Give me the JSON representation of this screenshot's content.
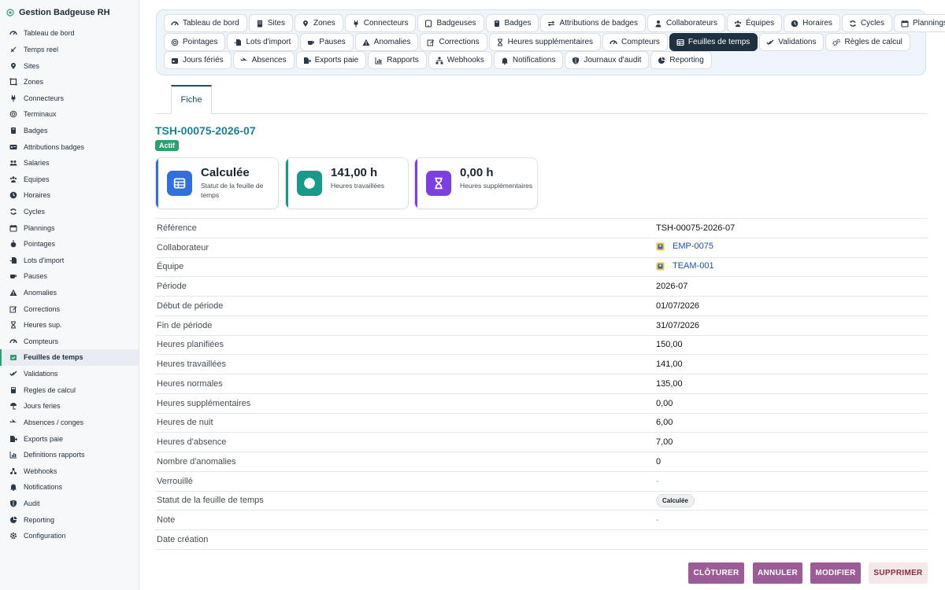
{
  "app": {
    "title": "Gestion Badgeuse RH"
  },
  "sidebar": {
    "items": [
      {
        "label": "Tableau de bord",
        "icon": "gauge-icon"
      },
      {
        "label": "Temps reel",
        "icon": "signal-icon"
      },
      {
        "label": "Sites",
        "icon": "map-pin-icon"
      },
      {
        "label": "Zones",
        "icon": "zone-icon"
      },
      {
        "label": "Connecteurs",
        "icon": "plug-icon"
      },
      {
        "label": "Terminaux",
        "icon": "fingerprint-icon"
      },
      {
        "label": "Badges",
        "icon": "badge-icon"
      },
      {
        "label": "Attributions badges",
        "icon": "id-card-icon"
      },
      {
        "label": "Salaries",
        "icon": "users-icon"
      },
      {
        "label": "Equipes",
        "icon": "team-icon"
      },
      {
        "label": "Horaires",
        "icon": "clock-icon"
      },
      {
        "label": "Cycles",
        "icon": "cycle-icon"
      },
      {
        "label": "Plannings",
        "icon": "calendar-icon"
      },
      {
        "label": "Pointages",
        "icon": "stopwatch-icon"
      },
      {
        "label": "Lots d'import",
        "icon": "file-import-icon"
      },
      {
        "label": "Pauses",
        "icon": "coffee-icon"
      },
      {
        "label": "Anomalies",
        "icon": "warning-icon"
      },
      {
        "label": "Corrections",
        "icon": "edit-icon"
      },
      {
        "label": "Heures sup.",
        "icon": "hourglass-icon"
      },
      {
        "label": "Compteurs",
        "icon": "gauge-icon"
      },
      {
        "label": "Feuilles de temps",
        "icon": "calendar-check-icon",
        "active": true
      },
      {
        "label": "Validations",
        "icon": "check-double-icon"
      },
      {
        "label": "Regles de calcul",
        "icon": "calculator-icon"
      },
      {
        "label": "Jours feries",
        "icon": "umbrella-beach-icon"
      },
      {
        "label": "Absences / conges",
        "icon": "plane-icon"
      },
      {
        "label": "Exports paie",
        "icon": "file-export-icon"
      },
      {
        "label": "Definitions rapports",
        "icon": "chart-icon"
      },
      {
        "label": "Webhooks",
        "icon": "webhook-icon"
      },
      {
        "label": "Notifications",
        "icon": "bell-icon"
      },
      {
        "label": "Audit",
        "icon": "shield-icon"
      },
      {
        "label": "Reporting",
        "icon": "pie-chart-icon"
      },
      {
        "label": "Configuration",
        "icon": "gear-icon"
      }
    ]
  },
  "tabs": {
    "rows": [
      [
        {
          "label": "Tableau de bord",
          "icon": "gauge-icon"
        },
        {
          "label": "Sites",
          "icon": "building-icon"
        },
        {
          "label": "Zones",
          "icon": "map-pin-icon"
        },
        {
          "label": "Connecteurs",
          "icon": "plug-icon"
        },
        {
          "label": "Badgeuses",
          "icon": "tablet-icon"
        },
        {
          "label": "Badges",
          "icon": "badge-icon"
        },
        {
          "label": "Attributions de badges",
          "icon": "exchange-icon"
        },
        {
          "label": "Collaborateurs",
          "icon": "user-icon"
        },
        {
          "label": "Équipes",
          "icon": "team-icon"
        },
        {
          "label": "Horaires",
          "icon": "clock-icon"
        },
        {
          "label": "Cycles",
          "icon": "cycle-icon"
        },
        {
          "label": "Plannings",
          "icon": "calendar-icon"
        }
      ],
      [
        {
          "label": "Pointages",
          "icon": "fingerprint-icon"
        },
        {
          "label": "Lots d'import",
          "icon": "file-import-icon"
        },
        {
          "label": "Pauses",
          "icon": "coffee-icon"
        },
        {
          "label": "Anomalies",
          "icon": "warning-icon"
        },
        {
          "label": "Corrections",
          "icon": "edit-icon"
        },
        {
          "label": "Heures supplémentaires",
          "icon": "hourglass-icon"
        },
        {
          "label": "Compteurs",
          "icon": "gauge-icon"
        },
        {
          "label": "Feuilles de temps",
          "icon": "table-icon",
          "active": true
        },
        {
          "label": "Validations",
          "icon": "check-double-icon"
        },
        {
          "label": "Règles de calcul",
          "icon": "gears-icon"
        }
      ],
      [
        {
          "label": "Jours fériés",
          "icon": "calendar-day-icon"
        },
        {
          "label": "Absences",
          "icon": "plane-icon"
        },
        {
          "label": "Exports paie",
          "icon": "file-export-icon"
        },
        {
          "label": "Rapports",
          "icon": "chart-icon"
        },
        {
          "label": "Webhooks",
          "icon": "sitemap-icon"
        },
        {
          "label": "Notifications",
          "icon": "bell-icon"
        },
        {
          "label": "Journaux d'audit",
          "icon": "shield-icon"
        },
        {
          "label": "Reporting",
          "icon": "pie-chart-icon"
        }
      ]
    ]
  },
  "form_tab": "Fiche",
  "record": {
    "title": "TSH-00075-2026-07",
    "status_badge": "Actif"
  },
  "cards": [
    {
      "value": "Calculée",
      "label": "Statut de la feuille de temps",
      "color": "#2f6fdf",
      "icon": "table-icon"
    },
    {
      "value": "141,00 h",
      "label": "Heures travaillées",
      "color": "#179a8a",
      "icon": "clock-icon"
    },
    {
      "value": "0,00 h",
      "label": "Heures supplémentaires",
      "color": "#7b3fe4",
      "icon": "hourglass-icon"
    }
  ],
  "fields": [
    {
      "label": "Référence",
      "value": "TSH-00075-2026-07"
    },
    {
      "label": "Collaborateur",
      "value": "EMP-0075",
      "kind": "link"
    },
    {
      "label": "Équipe",
      "value": "TEAM-001",
      "kind": "link"
    },
    {
      "label": "Période",
      "value": "2026-07"
    },
    {
      "label": "Début de période",
      "value": "01/07/2026"
    },
    {
      "label": "Fin de période",
      "value": "31/07/2026"
    },
    {
      "label": "Heures planifiées",
      "value": "150,00"
    },
    {
      "label": "Heures travaillées",
      "value": "141,00"
    },
    {
      "label": "Heures normales",
      "value": "135,00"
    },
    {
      "label": "Heures supplémentaires",
      "value": "0,00"
    },
    {
      "label": "Heures de nuit",
      "value": "6,00"
    },
    {
      "label": "Heures d'absence",
      "value": "7,00"
    },
    {
      "label": "Nombre d'anomalies",
      "value": "0"
    },
    {
      "label": "Verrouillé",
      "value": "-",
      "kind": "dash"
    },
    {
      "label": "Statut de la feuille de temps",
      "value": "Calculée",
      "kind": "chip"
    },
    {
      "label": "Note",
      "value": "-",
      "kind": "dash"
    },
    {
      "label": "Date création",
      "value": ""
    }
  ],
  "actions": {
    "close": "CLÔTURER",
    "cancel": "ANNULER",
    "edit": "MODIFIER",
    "delete": "SUPPRIMER"
  },
  "colors": {
    "accent": "#2f9e72",
    "title": "#1b8294",
    "action": "#9c5c98",
    "danger_bg": "#f4e8ea",
    "active_tab": "#1f3140"
  }
}
